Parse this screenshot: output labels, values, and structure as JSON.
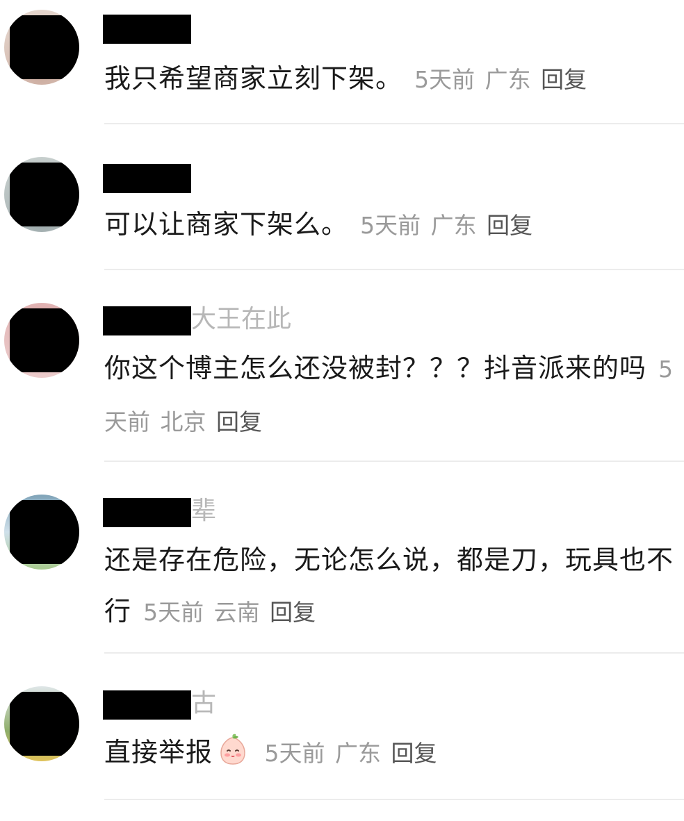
{
  "comments": [
    {
      "name_suffix": "",
      "text": "我只希望商家立刻下架。",
      "emoji": "",
      "time": "5天前",
      "location": "广东",
      "reply_label": "回复",
      "avatar_colors": [
        "#c9a79a",
        "#eadfd7"
      ]
    },
    {
      "name_suffix": "",
      "text": "可以让商家下架么。",
      "emoji": "",
      "time": "5天前",
      "location": "广东",
      "reply_label": "回复",
      "avatar_colors": [
        "#9aa7a9",
        "#cfd6d4"
      ]
    },
    {
      "name_suffix": "大王在此",
      "text": "你这个博主怎么还没被封？？？抖音派来的吗",
      "emoji": "",
      "time": "5天前",
      "location": "北京",
      "reply_label": "回复",
      "avatar_colors": [
        "#d9a0a0",
        "#f0d6d6"
      ]
    },
    {
      "name_suffix": "辈",
      "text": "还是存在危险，无论怎么说，都是刀，玩具也不行",
      "emoji": "",
      "time": "5天前",
      "location": "云南",
      "reply_label": "回复",
      "avatar_colors": [
        "#7fa3b8",
        "#a8c98f"
      ]
    },
    {
      "name_suffix": "古",
      "text": "直接举报",
      "emoji": "peach-smile-emoji",
      "time": "5天前",
      "location": "广东",
      "reply_label": "回复",
      "avatar_colors": [
        "#8fae6a",
        "#e0c25a"
      ]
    }
  ]
}
